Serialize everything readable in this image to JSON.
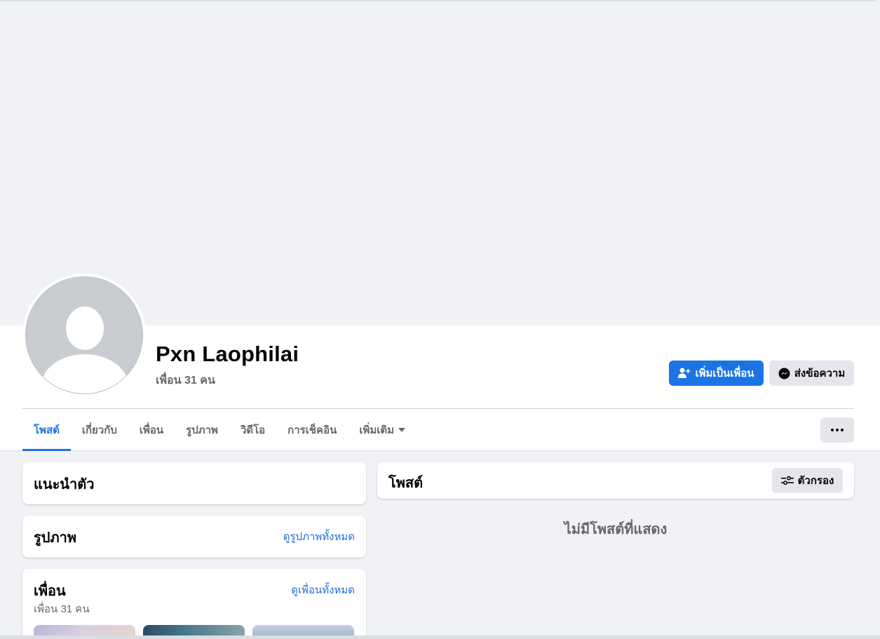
{
  "profile": {
    "name": "Pxn Laophilai",
    "friend_count_text": "เพื่อน 31 คน"
  },
  "actions": {
    "add_friend_label": "เพิ่มเป็นเพื่อน",
    "message_label": "ส่งข้อความ",
    "add_friend_icon": "person-add-icon",
    "message_icon": "messenger-icon",
    "more_icon": "more-horizontal-icon"
  },
  "tabs": [
    {
      "label": "โพสต์",
      "active": true
    },
    {
      "label": "เกี่ยวกับ",
      "active": false
    },
    {
      "label": "เพื่อน",
      "active": false
    },
    {
      "label": "รูปภาพ",
      "active": false
    },
    {
      "label": "วิดีโอ",
      "active": false
    },
    {
      "label": "การเช็คอิน",
      "active": false
    },
    {
      "label": "เพิ่มเติม",
      "active": false
    }
  ],
  "intro": {
    "title": "แนะนำตัว"
  },
  "photos": {
    "title": "รูปภาพ",
    "see_all": "ดูรูปภาพทั้งหมด"
  },
  "friends": {
    "title": "เพื่อน",
    "see_all": "ดูเพื่อนทั้งหมด",
    "count_text": "เพื่อน 31 คน"
  },
  "posts": {
    "title": "โพสต์",
    "filter_label": "ตัวกรอง",
    "filter_icon": "filter-sliders-icon",
    "empty_text": "ไม่มีโพสต์ที่แสดง"
  },
  "colors": {
    "accent": "#1b74e4",
    "link": "#216fdb",
    "background": "#f0f2f5",
    "secondary_button": "#e4e6eb",
    "muted_text": "#65676b"
  }
}
